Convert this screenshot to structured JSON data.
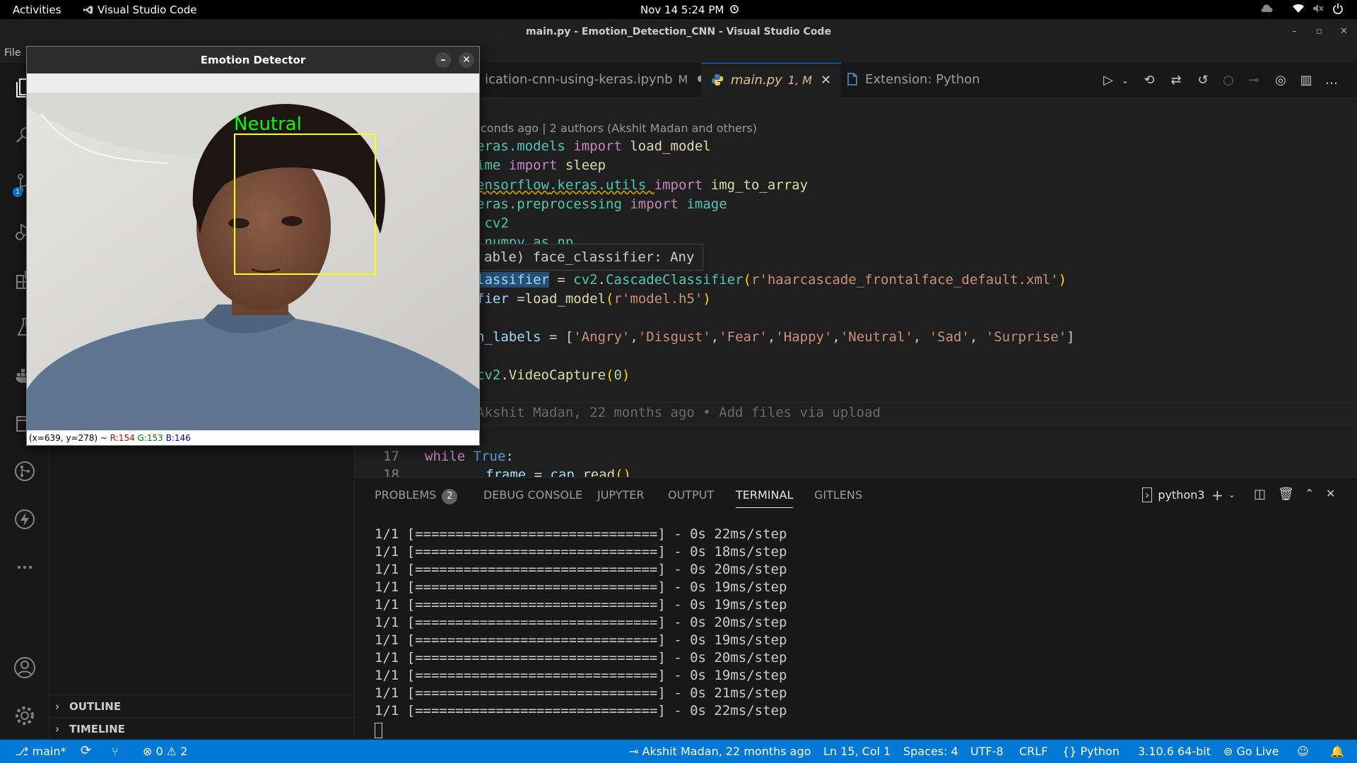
{
  "topbar": {
    "activities": "Activities",
    "app_name": "Visual Studio Code",
    "clock": "Nov 14  5:24 PM"
  },
  "window": {
    "title": "main.py - Emotion_Detection_CNN - Visual Studio Code"
  },
  "menu": {
    "file": "File"
  },
  "sidebar": {
    "outline": "OUTLINE",
    "timeline": "TIMELINE"
  },
  "tabs": [
    {
      "label": "ication-cnn-using-keras.ipynb",
      "status": "M"
    },
    {
      "label": "main.py",
      "status": "1, M"
    },
    {
      "label": "Extension: Python"
    }
  ],
  "editor": {
    "blame_header": "conds ago | 2 authors (Akshit Madan and others)",
    "hover": "able) face_classifier: Any",
    "inline_blame": "Akshit Madan, 22 months ago • Add files via upload",
    "line_numbers": [
      "17",
      "18"
    ],
    "code": {
      "l1_a": "eras",
      "l1_b": ".models ",
      "l1_c": "import",
      "l1_d": " load_model",
      "l2_a": "ime ",
      "l2_b": "import",
      "l2_c": " sleep",
      "l3_a": "ensorflow",
      "l3_b": ".keras.utils ",
      "l3_c": "import",
      "l3_d": " img_to_array",
      "l4_a": "eras",
      "l4_b": ".preprocessing ",
      "l4_c": "import",
      "l4_d": " image",
      "l5": " cv2",
      "l6": " numpy as np",
      "l8_a": "lassifier",
      "l8_b": " = ",
      "l8_c": "cv2",
      "l8_d": ".",
      "l8_e": "CascadeClassifier",
      "l8_f": "(",
      "l8_g": "r'haarcascade_frontalface_default.xml'",
      "l8_h": ")",
      "l9_a": "fier ",
      "l9_b": "=",
      "l9_c": "load_model",
      "l9_d": "(",
      "l9_e": "r'model.h5'",
      "l9_f": ")",
      "l11_a": "n_labels",
      "l11_b": " = [",
      "l11_c": "'Angry'",
      "l11_d": ",",
      "l11_e": "'Disgust'",
      "l11_f": ",",
      "l11_g": "'Fear'",
      "l11_h": ",",
      "l11_i": "'Happy'",
      "l11_j": ",",
      "l11_k": "'Neutral'",
      "l11_l": ", ",
      "l11_m": "'Sad'",
      "l11_n": ", ",
      "l11_o": "'Surprise'",
      "l11_p": "]",
      "l13_a": "cv2",
      "l13_b": ".",
      "l13_c": "VideoCapture",
      "l13_d": "(",
      "l13_e": "0",
      "l13_f": ")",
      "l17_a": "while",
      "l17_b": " True",
      "l17_c": ":",
      "l18_a": "frame",
      "l18_b": " = ",
      "l18_c": "cap",
      "l18_d": ".",
      "l18_e": "read",
      "l18_f": "()"
    }
  },
  "panel": {
    "tabs": [
      "PROBLEMS",
      "DEBUG CONSOLE",
      "JUPYTER",
      "OUTPUT",
      "TERMINAL",
      "GITLENS"
    ],
    "problems_count": "2",
    "shell": "python3",
    "terminal_lines": [
      "1/1 [==============================] - 0s 22ms/step",
      "1/1 [==============================] - 0s 18ms/step",
      "1/1 [==============================] - 0s 20ms/step",
      "1/1 [==============================] - 0s 19ms/step",
      "1/1 [==============================] - 0s 19ms/step",
      "1/1 [==============================] - 0s 20ms/step",
      "1/1 [==============================] - 0s 19ms/step",
      "1/1 [==============================] - 0s 20ms/step",
      "1/1 [==============================] - 0s 19ms/step",
      "1/1 [==============================] - 0s 21ms/step",
      "1/1 [==============================] - 0s 22ms/step"
    ]
  },
  "status": {
    "branch": "main*",
    "errors": "0",
    "warnings": "2",
    "blame": "Akshit Madan, 22 months ago",
    "position": "Ln 15, Col 1",
    "spaces": "Spaces: 4",
    "encoding": "UTF-8",
    "eol": "CRLF",
    "language": "Python",
    "interpreter": "3.10.6 64-bit",
    "golive": "Go Live"
  },
  "emotion_window": {
    "title": "Emotion Detector",
    "detected_label": "Neutral",
    "status_coords": "(x=639, y=278) ~ ",
    "status_r": "R:154",
    "status_g": "G:153",
    "status_b": "B:146"
  },
  "colors": {
    "accent": "#0078d4",
    "detect_box": "#ffff00",
    "detect_label": "#00ff00"
  }
}
